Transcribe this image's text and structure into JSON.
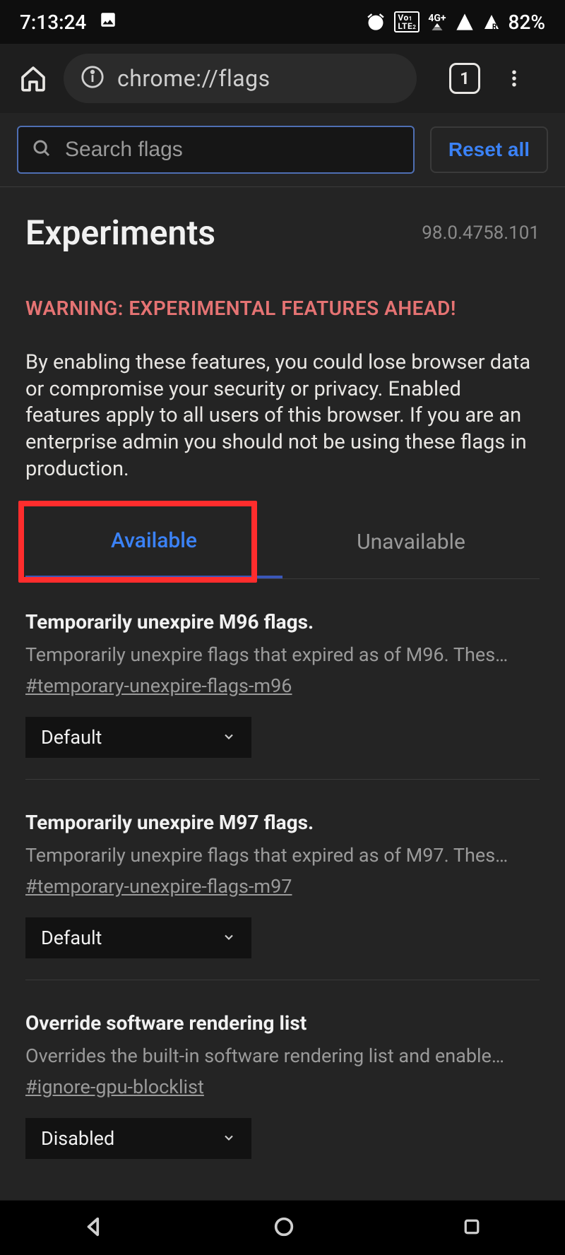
{
  "status": {
    "time": "7:13:24",
    "battery": "82%",
    "lte_badge": "LTE",
    "signal": "4G+"
  },
  "browser": {
    "url": "chrome://flags",
    "tab_count": "1"
  },
  "search": {
    "placeholder": "Search flags",
    "reset_label": "Reset all"
  },
  "header": {
    "title": "Experiments",
    "version": "98.0.4758.101"
  },
  "warning": {
    "headline": "WARNING: EXPERIMENTAL FEATURES AHEAD!",
    "desc": "By enabling these features, you could lose browser data or compromise your security or privacy. Enabled features apply to all users of this browser. If you are an enterprise admin you should not be using these flags in production."
  },
  "tabs": {
    "available": "Available",
    "unavailable": "Unavailable"
  },
  "flags": [
    {
      "title": "Temporarily unexpire M96 flags.",
      "desc": "Temporarily unexpire flags that expired as of M96. Thes…",
      "hash": "#temporary-unexpire-flags-m96",
      "value": "Default"
    },
    {
      "title": "Temporarily unexpire M97 flags.",
      "desc": "Temporarily unexpire flags that expired as of M97. Thes…",
      "hash": "#temporary-unexpire-flags-m97",
      "value": "Default"
    },
    {
      "title": "Override software rendering list",
      "desc": "Overrides the built-in software rendering list and enable…",
      "hash": "#ignore-gpu-blocklist",
      "value": "Disabled"
    }
  ]
}
